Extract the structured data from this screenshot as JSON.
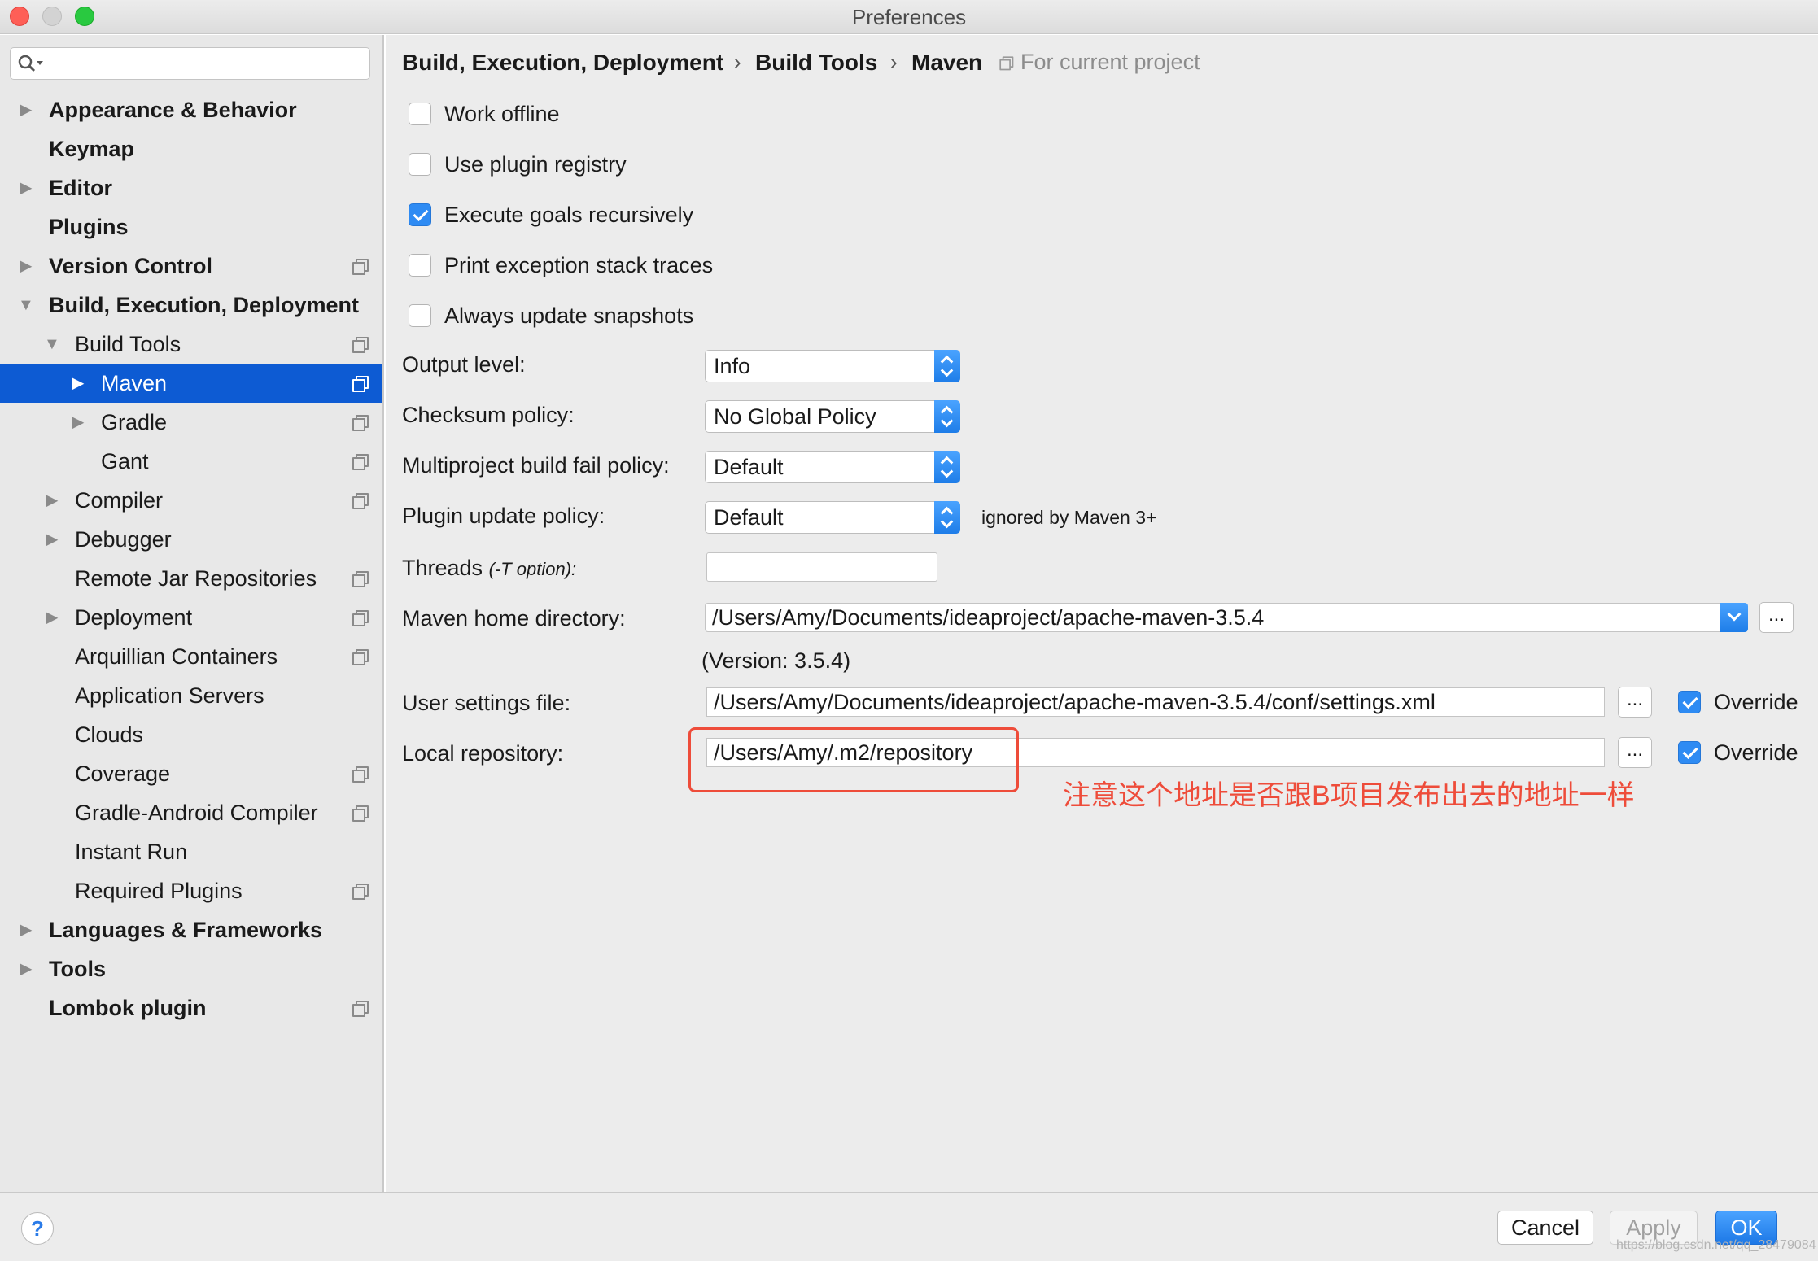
{
  "window": {
    "title": "Preferences"
  },
  "sidebar": {
    "search": {
      "placeholder": ""
    },
    "items": [
      {
        "label": "Appearance & Behavior"
      },
      {
        "label": "Keymap"
      },
      {
        "label": "Editor"
      },
      {
        "label": "Plugins"
      },
      {
        "label": "Version Control"
      },
      {
        "label": "Build, Execution, Deployment"
      },
      {
        "label": "Build Tools"
      },
      {
        "label": "Maven"
      },
      {
        "label": "Gradle"
      },
      {
        "label": "Gant"
      },
      {
        "label": "Compiler"
      },
      {
        "label": "Debugger"
      },
      {
        "label": "Remote Jar Repositories"
      },
      {
        "label": "Deployment"
      },
      {
        "label": "Arquillian Containers"
      },
      {
        "label": "Application Servers"
      },
      {
        "label": "Clouds"
      },
      {
        "label": "Coverage"
      },
      {
        "label": "Gradle-Android Compiler"
      },
      {
        "label": "Instant Run"
      },
      {
        "label": "Required Plugins"
      },
      {
        "label": "Languages & Frameworks"
      },
      {
        "label": "Tools"
      },
      {
        "label": "Lombok plugin"
      }
    ]
  },
  "breadcrumb": {
    "items": [
      "Build, Execution, Deployment",
      "Build Tools",
      "Maven"
    ],
    "hint": "For current project"
  },
  "options": {
    "work_offline": "Work offline",
    "use_plugin_registry": "Use plugin registry",
    "execute_goals_recursively": "Execute goals recursively",
    "print_exception_stack_traces": "Print exception stack traces",
    "always_update_snapshots": "Always update snapshots"
  },
  "fields": {
    "output_level": {
      "label": "Output level:",
      "value": "Info"
    },
    "checksum_policy": {
      "label": "Checksum policy:",
      "value": "No Global Policy"
    },
    "multiproject_fail_policy": {
      "label": "Multiproject build fail policy:",
      "value": "Default"
    },
    "plugin_update_policy": {
      "label": "Plugin update policy:",
      "value": "Default",
      "hint": "ignored by Maven 3+"
    },
    "threads": {
      "label": "Threads",
      "option": "(-T option):",
      "value": ""
    },
    "maven_home": {
      "label": "Maven home directory:",
      "value": "/Users/Amy/Documents/ideaproject/apache-maven-3.5.4",
      "version": "(Version: 3.5.4)"
    },
    "user_settings": {
      "label": "User settings file:",
      "value": "/Users/Amy/Documents/ideaproject/apache-maven-3.5.4/conf/settings.xml",
      "override": "Override"
    },
    "local_repo": {
      "label": "Local repository:",
      "value": "/Users/Amy/.m2/repository",
      "override": "Override"
    },
    "browse_label": "..."
  },
  "annotation": {
    "text": "注意这个地址是否跟B项目发布出去的地址一样",
    "color": "#ee4c3a"
  },
  "footer": {
    "help": "?",
    "cancel": "Cancel",
    "apply": "Apply",
    "ok": "OK",
    "watermark": "https://blog.csdn.net/qq_28479084"
  },
  "colors": {
    "selection": "#0d5bd3",
    "accent": "#2e8bf3"
  }
}
